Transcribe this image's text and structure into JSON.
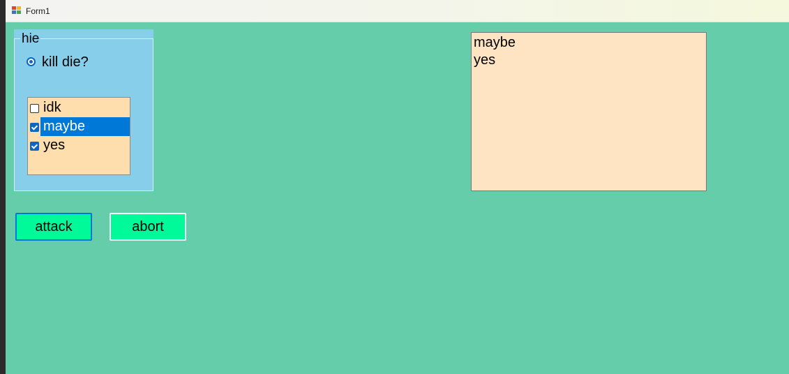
{
  "window": {
    "title": "Form1",
    "icon": "winforms-app-icon"
  },
  "colors": {
    "form_background": "#66cdaa",
    "groupbox_background": "#87ceeb",
    "checklist_background": "#ffdead",
    "button_background": "#00fa9a",
    "output_background": "#ffe4c4",
    "selection": "#0078d7"
  },
  "groupbox": {
    "title": "hie",
    "radio": {
      "label": "kill die?",
      "checked": true
    },
    "checklist": {
      "items": [
        {
          "label": "idk",
          "checked": false,
          "selected": false
        },
        {
          "label": "maybe",
          "checked": true,
          "selected": true
        },
        {
          "label": "yes",
          "checked": true,
          "selected": false
        }
      ]
    }
  },
  "buttons": {
    "attack_label": "attack",
    "abort_label": "abort"
  },
  "output": {
    "lines": [
      "maybe",
      "yes"
    ]
  }
}
